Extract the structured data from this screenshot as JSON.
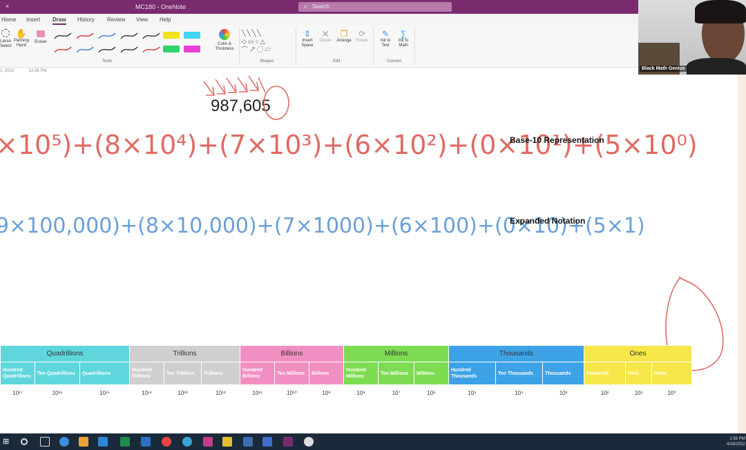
{
  "window": {
    "title": "MC180 - OneNote",
    "search_placeholder": "Search",
    "close_glyph": "×"
  },
  "tabs": [
    "Home",
    "Insert",
    "Draw",
    "History",
    "Review",
    "View",
    "Help"
  ],
  "active_tab": "Draw",
  "ribbon": {
    "lasso_label": "Lasso Select",
    "panning_label": "Panning Hand",
    "eraser_label": "Eraser",
    "color_label": "Color & Thickness",
    "insert_space_label": "Insert Space",
    "delete_label": "Delete",
    "arrange_label": "Arrange",
    "rotate_label": "Rotate",
    "ink_to_text_label": "Ink to Text",
    "ink_to_math_label": "Ink to Math",
    "groups": {
      "tools": "Tools",
      "shapes": "Shapes",
      "edit": "Edit",
      "convert": "Convert"
    }
  },
  "page": {
    "date": "1, 2022",
    "time": "12:38 PM",
    "number": "987,605",
    "base10_label": "Base-10 Representation",
    "expanded_label": "Expanded Notation",
    "base10_ink": "×10⁵)+(8×10⁴)+(7×10³)+(6×10²)+(0×10¹)+(5×10⁰)",
    "expanded_ink": "9×100,000)+(8×10,000)+(7×1000)+(6×100)+(0×10)+(5×1)"
  },
  "place_value_table": {
    "groups": [
      {
        "name": "Quadrillions",
        "color": "#5ed6dc"
      },
      {
        "name": "Trillions",
        "color": "#cfcfcf"
      },
      {
        "name": "Billions",
        "color": "#f28fc2"
      },
      {
        "name": "Millions",
        "color": "#7ddc52"
      },
      {
        "name": "Thousands",
        "color": "#3da2e6"
      },
      {
        "name": "Ones",
        "color": "#f7e74a"
      }
    ],
    "columns": [
      "Hundred Quadrillions",
      "Ten Quadrillions",
      "Quadrillions",
      "Hundred Trillions",
      "Ten Trillions",
      "Trillions",
      "Hundred Billions",
      "Ten Millions",
      "Billions",
      "Hundred Millions",
      "Ten Millions",
      "Millions",
      "Hundred Thousands",
      "Ten Thousands",
      "Thousands",
      "Hundreds",
      "Tens",
      "Ones"
    ],
    "powers": [
      "10¹⁷",
      "10¹⁶",
      "10¹⁵",
      "10¹⁴",
      "10¹³",
      "10¹²",
      "10¹¹",
      "10¹⁰",
      "10⁹",
      "10⁸",
      "10⁷",
      "10⁶",
      "10⁵",
      "10⁴",
      "10³",
      "10²",
      "10¹",
      "10⁰"
    ]
  },
  "webcam": {
    "name": "Black Math Genius"
  },
  "tray": {
    "time": "1:56 PM",
    "date": "4/26/2022"
  }
}
